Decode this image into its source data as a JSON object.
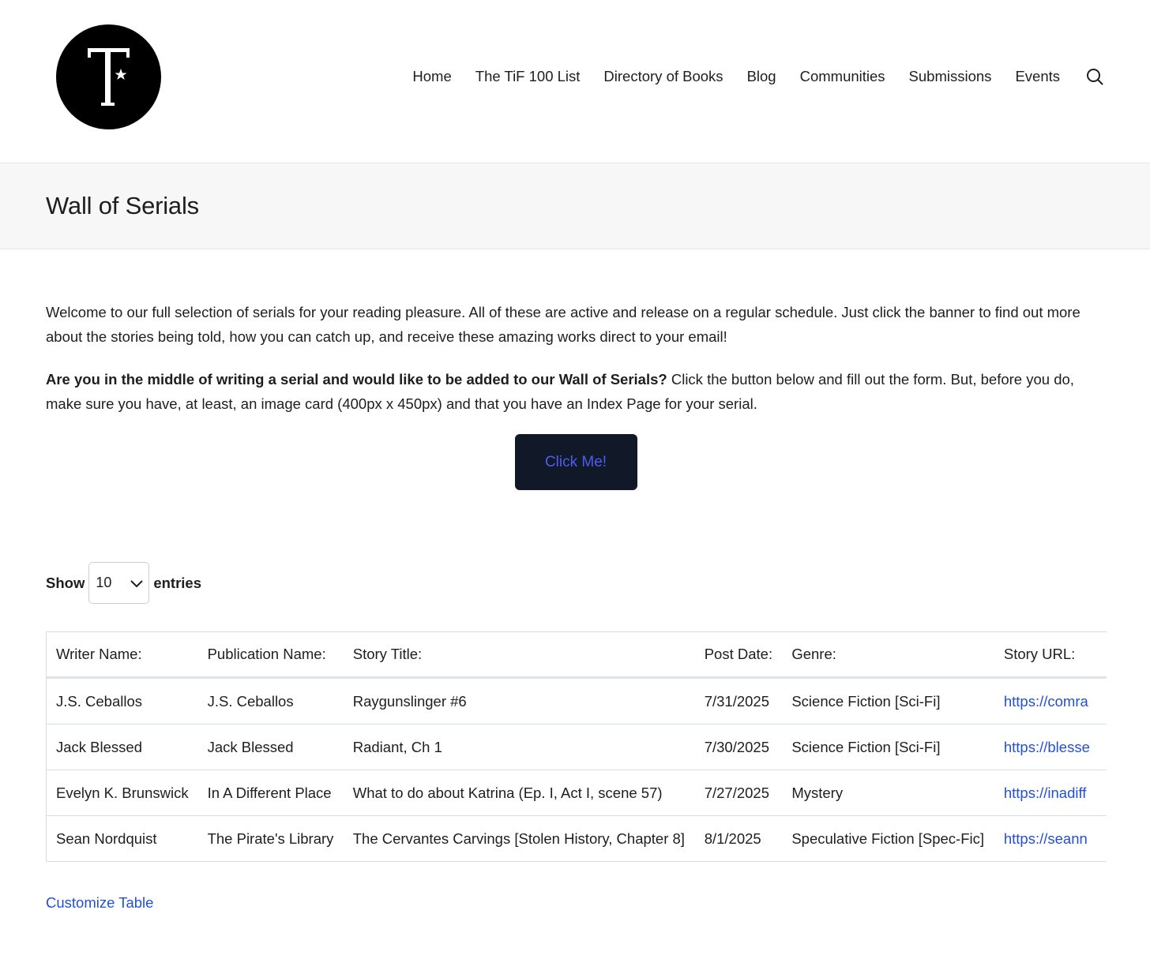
{
  "brand": {
    "logo_letter": "T"
  },
  "nav": {
    "items": [
      {
        "label": "Home"
      },
      {
        "label": "The TiF 100 List"
      },
      {
        "label": "Directory of Books"
      },
      {
        "label": "Blog"
      },
      {
        "label": "Communities"
      },
      {
        "label": "Submissions"
      },
      {
        "label": "Events"
      }
    ],
    "search_icon": "search-icon"
  },
  "page": {
    "title": "Wall of Serials"
  },
  "intro": {
    "paragraph1": "Welcome to our full selection of serials for your reading pleasure. All of these are active and release on a regular schedule. Just click the banner to find out more about the stories being told, how you can catch up, and receive these amazing works direct to your email!",
    "paragraph2_bold": "Are you in the middle of writing a serial and would like to be added to our Wall of Serials?",
    "paragraph2_rest": " Click the button below and fill out the form. But, before you do, make sure you have, at least, an image card (400px x 450px) and that you have an Index Page for your serial."
  },
  "cta": {
    "label": "Click Me!"
  },
  "table_controls": {
    "show_label": "Show",
    "entries_label": "entries",
    "page_length": "10"
  },
  "table": {
    "headers": [
      "Writer Name:",
      "Publication Name:",
      "Story Title:",
      "Post Date:",
      "Genre:",
      "Story URL:"
    ],
    "rows": [
      [
        "J.S. Ceballos",
        "J.S. Ceballos",
        "Raygunslinger #6",
        "7/31/2025",
        "Science Fiction [Sci-Fi]",
        "https://comra"
      ],
      [
        "Jack Blessed",
        "Jack Blessed",
        "Radiant, Ch 1",
        "7/30/2025",
        "Science Fiction [Sci-Fi]",
        "https://blesse"
      ],
      [
        "Evelyn K. Brunswick",
        "In A Different Place",
        "What to do about Katrina (Ep. I, Act I, scene 57)",
        "7/27/2025",
        "Mystery",
        "https://inadiff"
      ],
      [
        "Sean Nordquist",
        "The Pirate's Library",
        "The Cervantes Carvings [Stolen History, Chapter 8]",
        "8/1/2025",
        "Speculative Fiction [Spec-Fic]",
        "https://seann"
      ]
    ]
  },
  "footer_link": {
    "label": "Customize Table"
  },
  "colors": {
    "cta_bg": "#111827",
    "cta_text": "#4f5cf0",
    "link": "#2250d6",
    "title_band": "#f7f7f7"
  }
}
